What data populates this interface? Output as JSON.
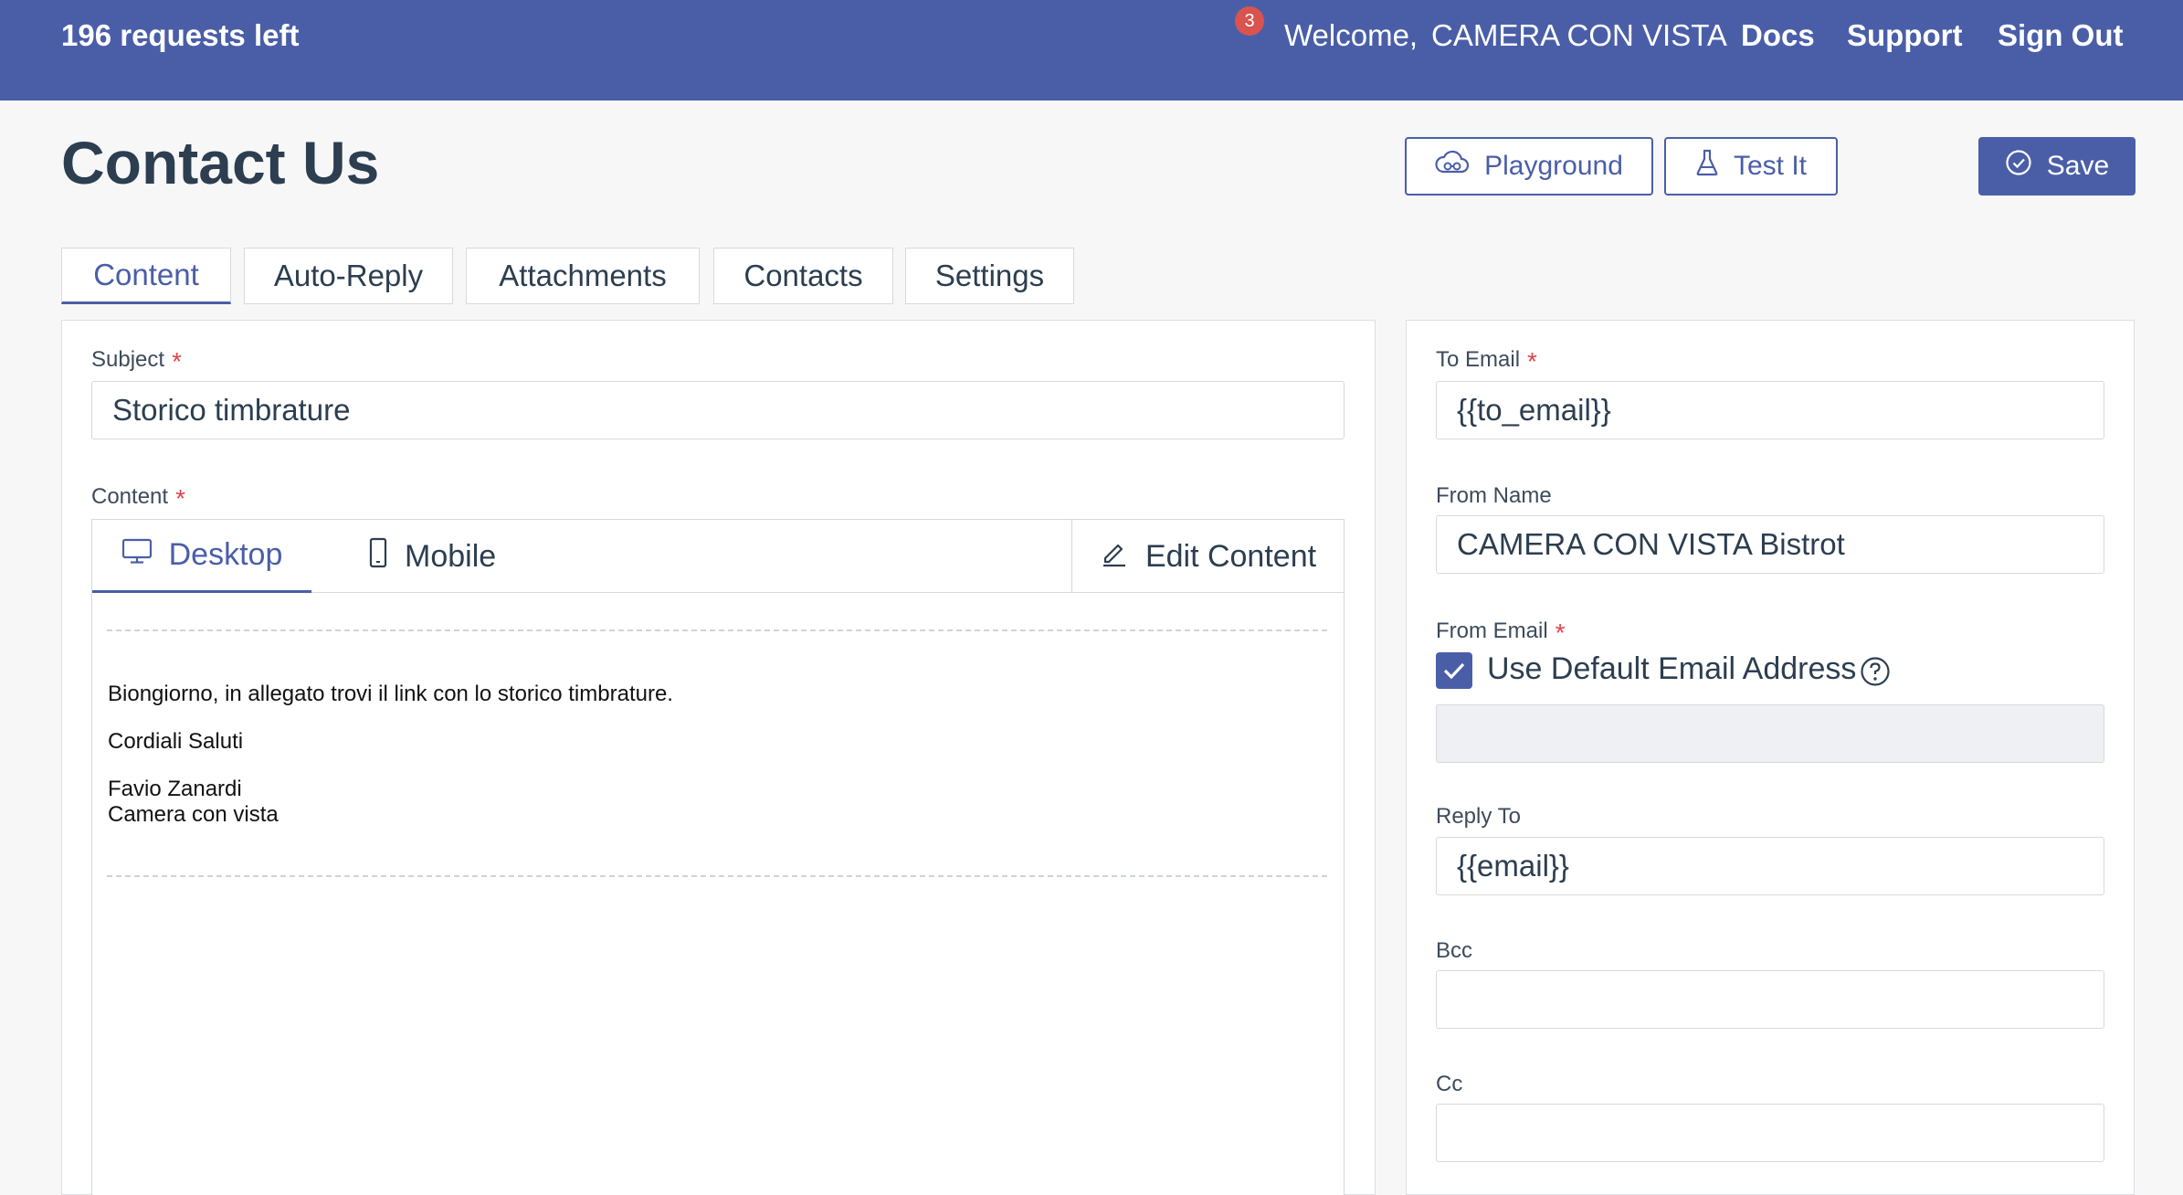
{
  "topbar": {
    "requests_left": "196 requests left",
    "notification_count": "3",
    "welcome": "Welcome,",
    "username": "CAMERA CON VISTA",
    "links": [
      "Docs",
      "Support",
      "Sign Out"
    ]
  },
  "header": {
    "title": "Contact Us",
    "playground_label": "Playground",
    "test_label": "Test It",
    "save_label": "Save"
  },
  "tabs": [
    "Content",
    "Auto-Reply",
    "Attachments",
    "Contacts",
    "Settings"
  ],
  "active_tab": "Content",
  "left": {
    "subject_label": "Subject",
    "subject_value": "Storico timbrature",
    "content_label": "Content",
    "editor": {
      "desktop_label": "Desktop",
      "mobile_label": "Mobile",
      "edit_label": "Edit Content",
      "lines": [
        "Biongiorno, in allegato trovi il link con lo storico timbrature.",
        "Cordiali Saluti",
        "Favio Zanardi",
        "Camera con vista"
      ]
    }
  },
  "right": {
    "to_email_label": "To Email",
    "to_email_value": "{{to_email}}",
    "from_name_label": "From Name",
    "from_name_value": "CAMERA CON VISTA Bistrot",
    "from_email_label": "From Email",
    "use_default_label": "Use Default Email Address",
    "use_default_checked": true,
    "from_email_value": "",
    "reply_to_label": "Reply To",
    "reply_to_value": "{{email}}",
    "bcc_label": "Bcc",
    "bcc_value": "",
    "cc_label": "Cc",
    "cc_value": ""
  },
  "required_mark": "*",
  "colors": {
    "brand": "#4a5ea8",
    "required": "#e0434b",
    "badge": "#d9534f"
  }
}
